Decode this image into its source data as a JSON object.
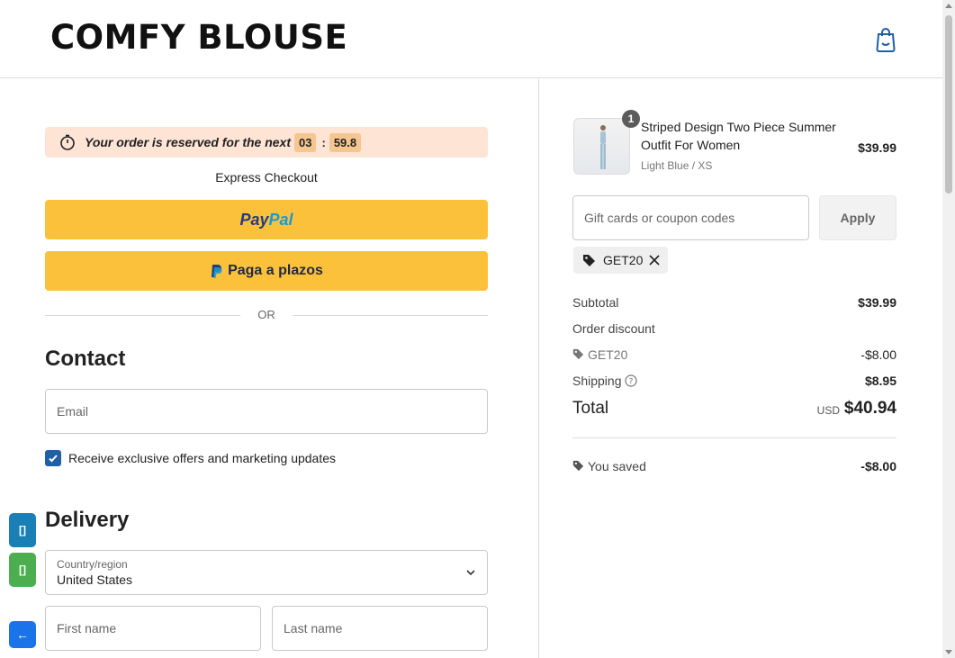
{
  "header": {
    "logo": "COMFY BLOUSE",
    "cart_icon": "shopping-bag-icon"
  },
  "reservation": {
    "text": "Your order is reserved for the next",
    "minutes": "03",
    "separator": ":",
    "seconds": "59.8",
    "icon": "stopwatch-icon"
  },
  "express": {
    "label": "Express Checkout",
    "paypal_part1": "Pay",
    "paypal_part2": "Pal",
    "plazos_label": "Paga a plazos",
    "or_label": "OR",
    "button_color": "#fcc13b"
  },
  "contact": {
    "title": "Contact",
    "email_placeholder": "Email",
    "marketing_label": "Receive exclusive offers and marketing updates",
    "marketing_checked": true
  },
  "delivery": {
    "title": "Delivery",
    "country_label": "Country/region",
    "country_value": "United States",
    "first_name_placeholder": "First name",
    "last_name_placeholder": "Last name"
  },
  "side_buttons": [
    {
      "label": "[]",
      "color": "#1a7fb5"
    },
    {
      "label": "[]",
      "color": "#4cae4f"
    },
    {
      "label": "←",
      "color": "#1a73e8"
    }
  ],
  "order": {
    "item": {
      "quantity": "1",
      "name": "Striped Design Two Piece Summer Outfit For Women",
      "variant": "Light Blue / XS",
      "price": "$39.99"
    },
    "coupon_placeholder": "Gift cards or coupon codes",
    "apply_label": "Apply",
    "applied_code": "GET20",
    "subtotal_label": "Subtotal",
    "subtotal_value": "$39.99",
    "order_discount_label": "Order discount",
    "discount_code": "GET20",
    "discount_value": "-$8.00",
    "shipping_label": "Shipping",
    "shipping_value": "$8.95",
    "total_label": "Total",
    "total_currency": "USD",
    "total_value": "$40.94",
    "saved_label": "You saved",
    "saved_value": "-$8.00"
  }
}
